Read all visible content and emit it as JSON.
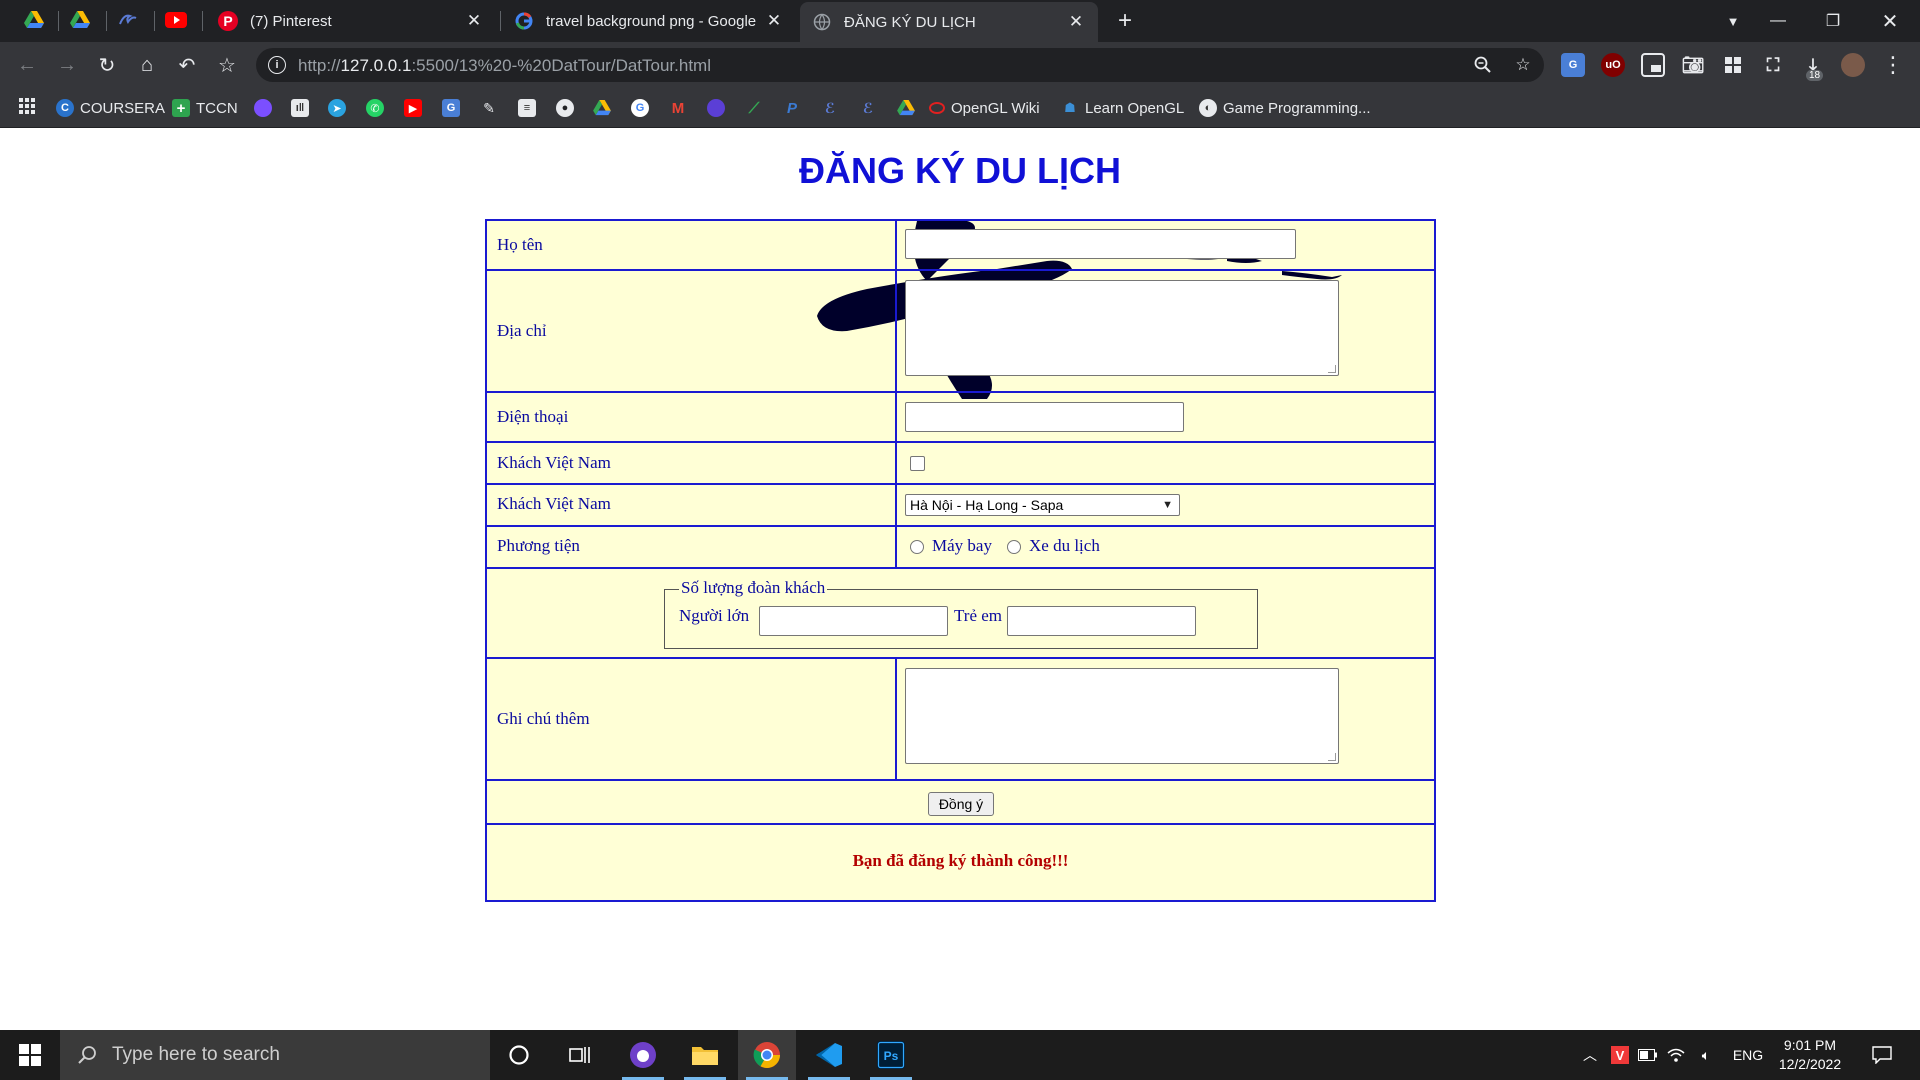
{
  "browser": {
    "tabs": [
      {
        "title": "(7) Pinterest",
        "icon": "pinterest-icon"
      },
      {
        "title": "travel background png - Google",
        "icon": "google-icon"
      },
      {
        "title": "ĐĂNG KÝ DU LỊCH",
        "icon": "page-icon"
      }
    ],
    "url_scheme": "http://",
    "url_host": "127.0.0.1",
    "url_path": ":5500/13%20-%20DatTour/DatTour.html",
    "bookmarks": {
      "coursera": "COURSERA",
      "tccn": "TCCN",
      "opengl_wiki": "OpenGL Wiki",
      "learn_opengl": "Learn OpenGL",
      "game_programming": "Game Programming..."
    },
    "download_badge": "18"
  },
  "page": {
    "title": "ĐĂNG KÝ DU LỊCH",
    "labels": {
      "name": "Họ tên",
      "address": "Địa chỉ",
      "phone": "Điện thoại",
      "vn_guest": "Khách Việt Nam",
      "tour": "Khách Việt Nam",
      "transport": "Phương tiện",
      "notes": "Ghi chú thêm"
    },
    "tour_selected": "Hà Nội - Hạ Long - Sapa",
    "transport_options": [
      "Máy bay",
      "Xe du lịch"
    ],
    "group_legend": "Số lượng đoàn khách",
    "adults_label": "Người lớn",
    "children_label": "Trẻ em",
    "submit_label": "Đồng ý",
    "success_message": "Bạn đã đăng ký thành công!!!"
  },
  "taskbar": {
    "search_placeholder": "Type here to search",
    "language": "ENG",
    "time": "9:01 PM",
    "date": "12/2/2022"
  },
  "colors": {
    "title_blue": "#1010d6",
    "form_bg": "#ffffd6",
    "border_blue": "#1a1ad1",
    "success_red": "#b30000"
  }
}
